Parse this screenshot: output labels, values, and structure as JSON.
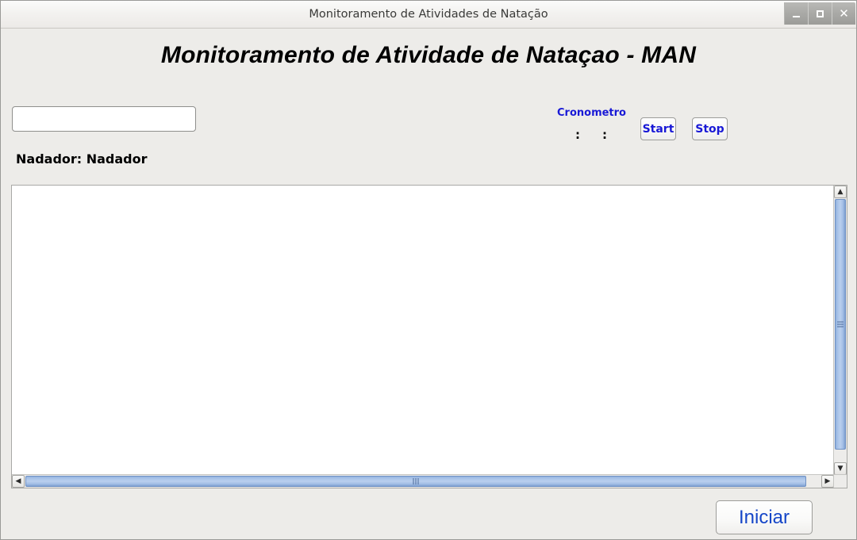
{
  "window": {
    "title": "Monitoramento de Atividades de Natação",
    "controls": {
      "minimize": "minimize-icon",
      "maximize": "maximize-icon",
      "close": "close-icon"
    }
  },
  "heading": "Monitoramento de Atividade de Nataçao - MAN",
  "form": {
    "swimmer_input_value": "",
    "swimmer_input_placeholder": "",
    "swimmer_label": "Nadador: Nadador"
  },
  "chronometer": {
    "title": "Cronometro",
    "fields": {
      "hours": "",
      "minutes": "",
      "seconds": ""
    },
    "separator": ":",
    "start_label": "Start",
    "stop_label": "Stop"
  },
  "log": {
    "content": ""
  },
  "scrollbars": {
    "vertical": {
      "up_arrow": "▲",
      "down_arrow": "▼"
    },
    "horizontal": {
      "left_arrow": "◀",
      "right_arrow": "▶"
    }
  },
  "actions": {
    "start_label": "Iniciar"
  },
  "colors": {
    "accent_blue": "#1919d6",
    "button_blue": "#1546c8",
    "scrollbar_blue": "#b9cfee",
    "window_bg": "#edece9"
  }
}
